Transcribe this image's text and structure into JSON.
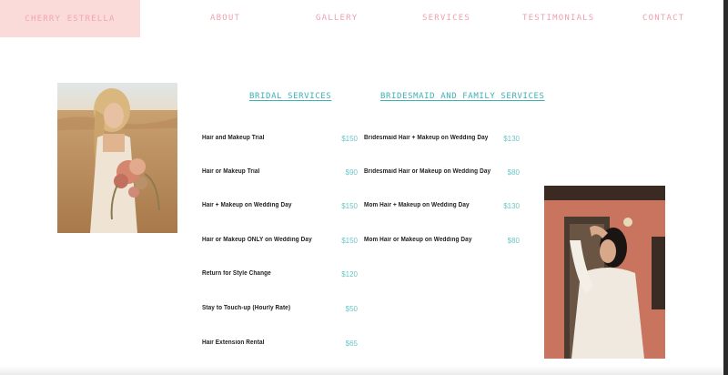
{
  "brand": {
    "name": "CHERRY ESTRELLA"
  },
  "nav": {
    "items": [
      {
        "label": "ABOUT"
      },
      {
        "label": "GALLERY"
      },
      {
        "label": "SERVICES"
      },
      {
        "label": "TESTIMONIALS"
      },
      {
        "label": "CONTACT"
      }
    ]
  },
  "bridal": {
    "title": "BRIDAL SERVICES",
    "items": [
      {
        "name": "Hair and Makeup Trial",
        "price": "$150"
      },
      {
        "name": "Hair or Makeup Trial",
        "price": "$90"
      },
      {
        "name": "Hair + Makeup on Wedding Day",
        "price": "$150"
      },
      {
        "name": "Hair or Makeup ONLY on Wedding Day",
        "price": "$150"
      },
      {
        "name": "Return for Style Change",
        "price": "$120"
      },
      {
        "name": "Stay to Touch-up (Hourly Rate)",
        "price": "$50"
      },
      {
        "name": "Hair Extension Rental",
        "price": "$65"
      }
    ]
  },
  "bridesmaid": {
    "title": "BRIDESMAID AND FAMILY SERVICES",
    "items": [
      {
        "name": "Bridesmaid Hair + Makeup on Wedding Day",
        "price": "$130"
      },
      {
        "name": "Bridesmaid Hair or Makeup on Wedding Day",
        "price": "$80"
      },
      {
        "name": "Mom Hair + Makeup on Wedding Day",
        "price": "$130"
      },
      {
        "name": "Mom Hair or Makeup on Wedding Day",
        "price": "$80"
      }
    ]
  },
  "colors": {
    "brand_bg": "#fbdada",
    "nav_pink": "#ef9fb0",
    "heading_teal": "#3fb0b5",
    "price_teal": "#6cc6c6"
  }
}
